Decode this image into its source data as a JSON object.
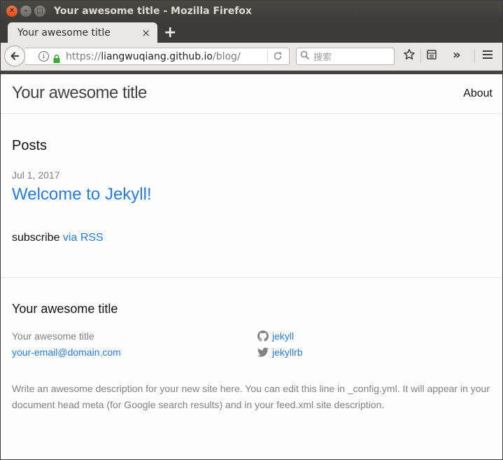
{
  "window": {
    "title": "Your awesome title - Mozilla Firefox"
  },
  "tab": {
    "title": "Your awesome title",
    "close_glyph": "×",
    "new_tab_glyph": "+"
  },
  "navbar": {
    "url_prefix": "https://",
    "url_host": "liangwuqiang.github.io",
    "url_path": "/blog/",
    "search_placeholder": "搜索",
    "overflow_glyph": "»"
  },
  "site": {
    "title": "Your awesome title",
    "nav_about": "About"
  },
  "main": {
    "posts_heading": "Posts",
    "posts": [
      {
        "date": "Jul 1, 2017",
        "title": "Welcome to Jekyll!"
      }
    ],
    "subscribe_text": "subscribe ",
    "subscribe_link": "via RSS"
  },
  "footer": {
    "heading": "Your awesome title",
    "name": "Your awesome title",
    "email": "your-email@domain.com",
    "github": "jekyll",
    "twitter": "jekyllrb",
    "description": "Write an awesome description for your new site here. You can edit this line in _config.yml. It will appear in your document head meta (for Google search results) and in your feed.xml site description."
  },
  "colors": {
    "link": "#2a7ae2",
    "grey_text": "#828282",
    "titlebar": "#3c3b37",
    "close_button": "#df4b16"
  }
}
